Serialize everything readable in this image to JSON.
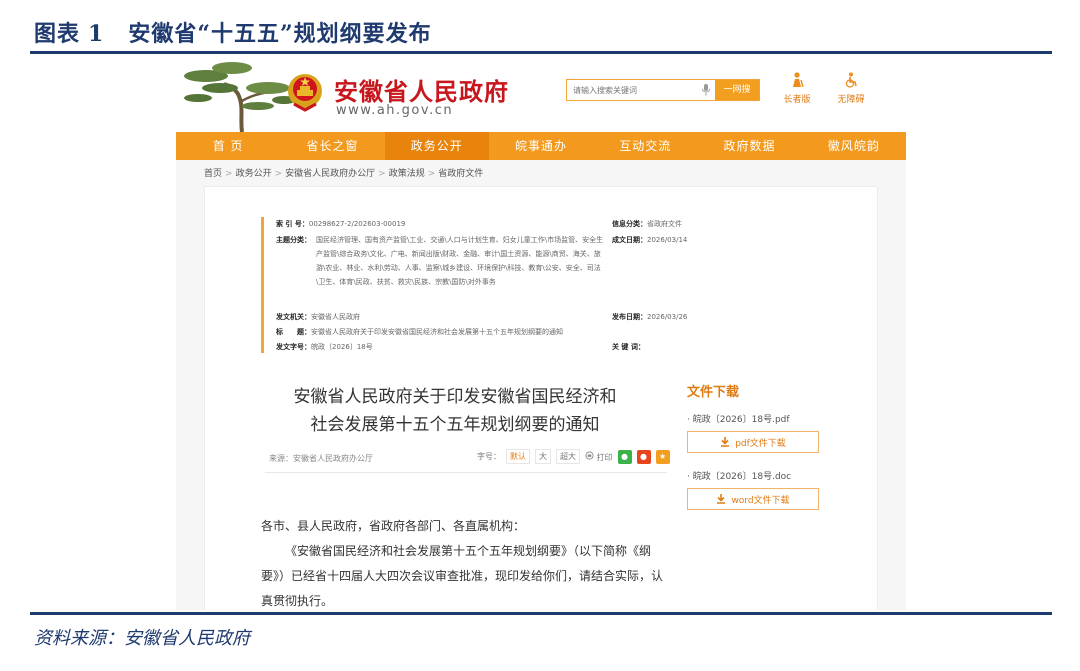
{
  "figure": {
    "label": "图表",
    "number": "1",
    "caption": "安徽省“十五五”规划纲要发布",
    "source": "资料来源：安徽省人民政府"
  },
  "site": {
    "name": "安徽省人民政府",
    "url": "www.ah.gov.cn",
    "search_placeholder": "请输入搜索关键词",
    "search_button": "一网搜",
    "tool_elder": "长者版",
    "tool_accessible": "无障碍"
  },
  "nav": [
    "首 页",
    "省长之窗",
    "政务公开",
    "皖事通办",
    "互动交流",
    "政府数据",
    "徽风皖韵"
  ],
  "breadcrumb": [
    "首页",
    "政务公开",
    "安徽省人民政府办公厅",
    "政策法规",
    "省政府文件"
  ],
  "meta": {
    "index_label": "索 引 号：",
    "index_value": "00298627-2/202603-00019",
    "info_cat_label": "信息分类：",
    "info_cat_value": "省政府文件",
    "topic_label": "主题分类：",
    "topic_value": "国民经济管理、国有资产监管\\工业、交通\\人口与计划生育、妇女儿童工作\\市场监管、安全生产监管\\综合政务\\文化、广电、新闻出版\\财政、金融、审计\\国土资源、能源\\商贸、海关、旅游\\农业、林业、水利\\劳动、人事、监察\\城乡建设、环境保护\\科技、教育\\公安、安全、司法\\卫生、体育\\民政、扶贫、救灾\\民族、宗教\\国防\\对外事务",
    "created_label": "成文日期：",
    "created_value": "2026/03/14",
    "issuer_label": "发文机关：",
    "issuer_value": "安徽省人民政府",
    "published_label": "发布日期：",
    "published_value": "2026/03/26",
    "title_label": "标　　题：",
    "title_value": "安徽省人民政府关于印发安徽省国民经济和社会发展第十五个五年规划纲要的通知",
    "docno_label": "发文字号：",
    "docno_value": "皖政〔2026〕18号",
    "keywords_label": "关 键 词："
  },
  "doc": {
    "title_line1": "安徽省人民政府关于印发安徽省国民经济和",
    "title_line2": "社会发展第十五个五年规划纲要的通知",
    "source": "来源：安徽省人民政府办公厅",
    "font_label": "字号：",
    "size_default": "默认",
    "size_large": "大",
    "size_xlarge": "超大",
    "print": "打印",
    "salutation": "各市、县人民政府，省政府各部门、各直属机构：",
    "body": "《安徽省国民经济和社会发展第十五个五年规划纲要》（以下简称《纲要》）已经省十四届人大四次会议审查批准，现印发给你们，请结合实际，认真贯彻执行。"
  },
  "downloads": {
    "title": "文件下载",
    "pdf_name": "· 皖政〔2026〕18号.pdf",
    "pdf_button": "pdf文件下载",
    "doc_name": "· 皖政〔2026〕18号.doc",
    "doc_button": "word文件下载"
  },
  "colors": {
    "report_navy": "#1f3a6e",
    "nav_orange": "#f39a1e",
    "brand_red": "#c8161d"
  }
}
